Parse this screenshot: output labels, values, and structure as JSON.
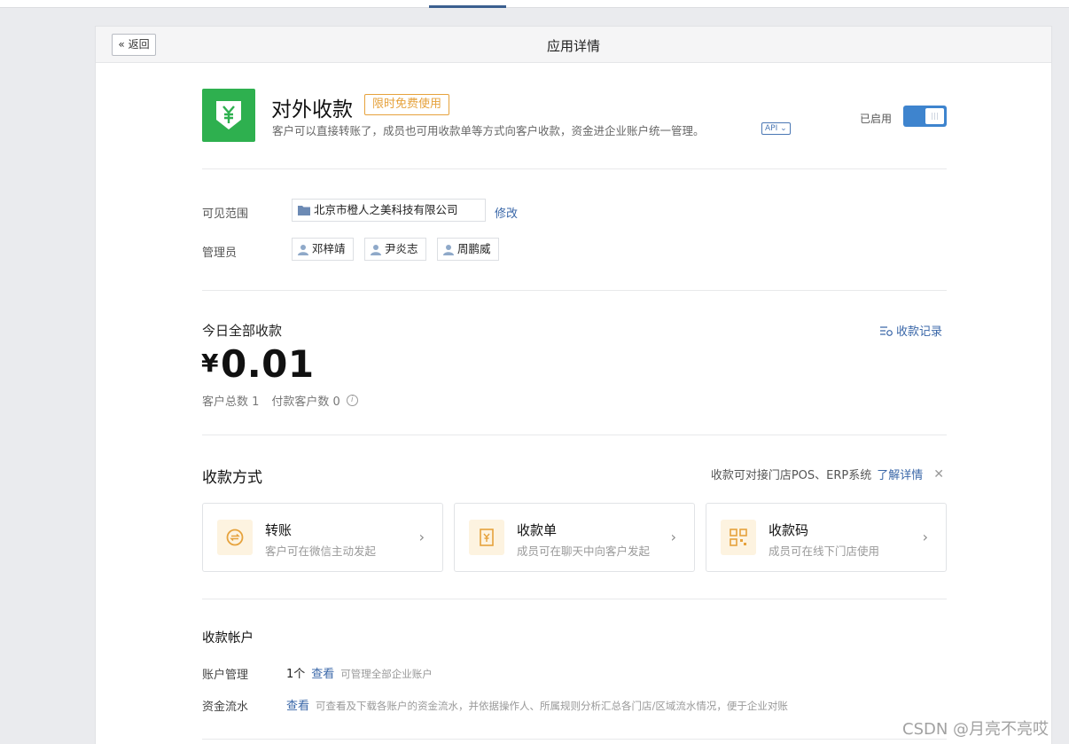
{
  "header": {
    "back_label": "返回",
    "title": "应用详情"
  },
  "app": {
    "logo_icon": "yen-shield-icon",
    "name": "对外收款",
    "badge": "限时免费使用",
    "description": "客户可以直接转账了，成员也可用收款单等方式向客户收款，资金进企业账户统一管理。",
    "api_tag": "API",
    "status_label": "已启用",
    "enabled": true
  },
  "visibility": {
    "label": "可见范围",
    "org": "北京市橙人之美科技有限公司",
    "modify_label": "修改"
  },
  "admins": {
    "label": "管理员",
    "people": [
      "邓梓靖",
      "尹炎志",
      "周鹏威"
    ]
  },
  "today": {
    "label": "今日全部收款",
    "records_link": "收款记录",
    "currency": "¥",
    "amount": "0.01",
    "customers_total": "客户总数 1",
    "paying_customers": "付款客户数 0"
  },
  "methods": {
    "title": "收款方式",
    "note": "收款可对接门店POS、ERP系统",
    "learn_more": "了解详情",
    "cards": [
      {
        "title": "转账",
        "subtitle": "客户可在微信主动发起",
        "icon": "transfer-icon"
      },
      {
        "title": "收款单",
        "subtitle": "成员可在聊天中向客户发起",
        "icon": "receipt-icon"
      },
      {
        "title": "收款码",
        "subtitle": "成员可在线下门店使用",
        "icon": "qrcode-icon"
      }
    ]
  },
  "accounts": {
    "title": "收款帐户",
    "manage_label": "账户管理",
    "manage_count": "1个",
    "manage_link": "查看",
    "manage_hint": "可管理全部企业账户",
    "flow_label": "资金流水",
    "flow_link": "查看",
    "flow_hint": "可查看及下载各账户的资金流水，并依据操作人、所属规则分析汇总各门店/区域流水情况，便于企业对账"
  },
  "watermark": "CSDN @月亮不亮哎",
  "colors": {
    "accent": "#3a67a8",
    "brand_green": "#2eb04f",
    "badge_orange": "#e6a23c",
    "toggle_blue": "#3e84ce"
  }
}
